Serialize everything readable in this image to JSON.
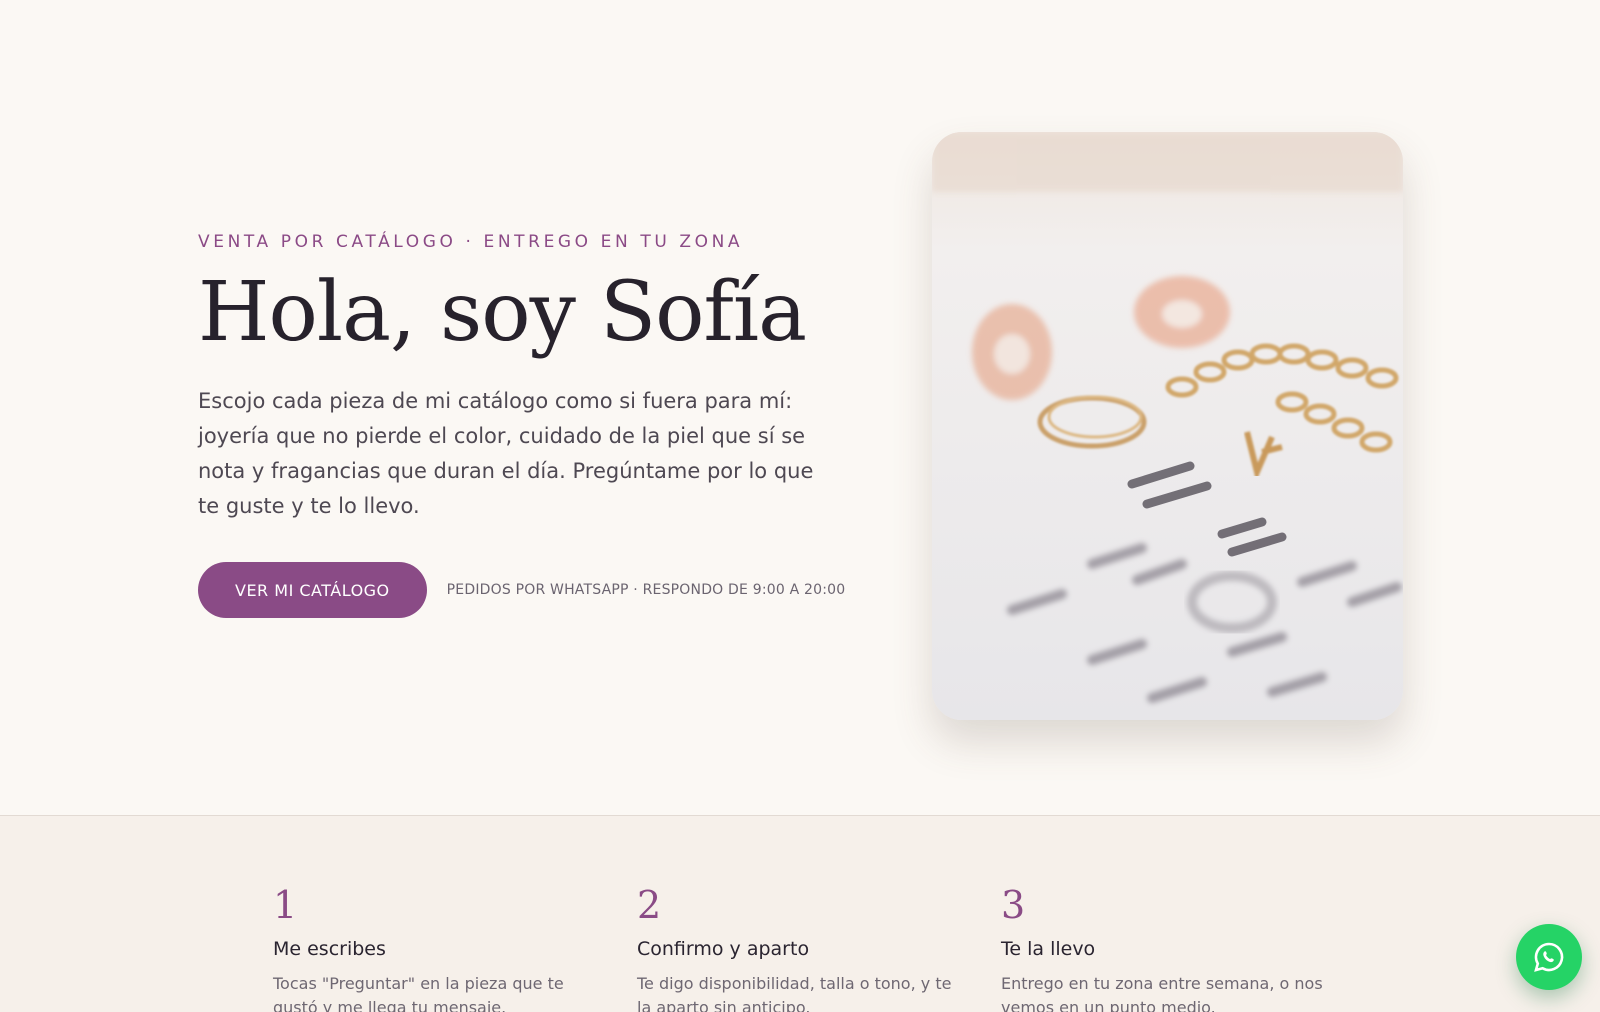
{
  "hero": {
    "eyebrow": "VENTA POR CATÁLOGO · ENTREGO EN TU ZONA",
    "title": "Hola, soy Sofía",
    "lead": "Escojo cada pieza de mi catálogo como si fuera para mí: joyería que no pierde el color, cuidado de la piel que sí se nota y fragancias que duran el día. Pregúntame por lo que te guste y te lo llevo.",
    "cta_label": "VER MI CATÁLOGO",
    "cta_note": "PEDIDOS POR WHATSAPP · RESPONDO DE 9:00 A 20:00"
  },
  "steps": [
    {
      "number": "1",
      "title": "Me escribes",
      "desc": "Tocas \"Preguntar\" en la pieza que te gustó y me llega tu mensaje."
    },
    {
      "number": "2",
      "title": "Confirmo y aparto",
      "desc": "Te digo disponibilidad, talla o tono, y te la aparto sin anticipo."
    },
    {
      "number": "3",
      "title": "Te la llevo",
      "desc": "Entrego en tu zona entre semana, o nos vemos en un punto medio."
    }
  ],
  "fab": {
    "icon": "whatsapp-icon"
  },
  "colors": {
    "accent": "#8a4b86",
    "background": "#fbf8f4",
    "steps_background": "#f6f0ea",
    "whatsapp": "#25d366"
  }
}
